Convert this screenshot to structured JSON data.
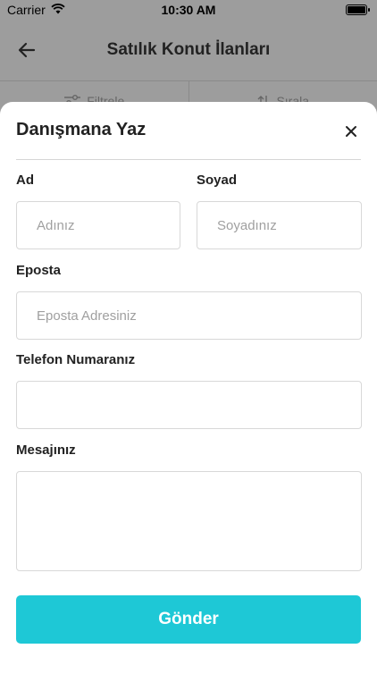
{
  "status_bar": {
    "carrier": "Carrier",
    "time": "10:30 AM"
  },
  "navbar": {
    "title": "Satılık Konut İlanları"
  },
  "subbar": {
    "filter_label": "Filtrele",
    "sort_label": "Sırala"
  },
  "modal": {
    "title": "Danışmana Yaz",
    "first_name_label": "Ad",
    "first_name_placeholder": "Adınız",
    "last_name_label": "Soyad",
    "last_name_placeholder": "Soyadınız",
    "email_label": "Eposta",
    "email_placeholder": "Eposta Adresiniz",
    "phone_label": "Telefon Numaranız",
    "phone_value": "",
    "message_label": "Mesajınız",
    "message_value": "",
    "submit_label": "Gönder"
  },
  "colors": {
    "accent": "#1ec8d6",
    "backdrop": "#9d9d9d"
  }
}
